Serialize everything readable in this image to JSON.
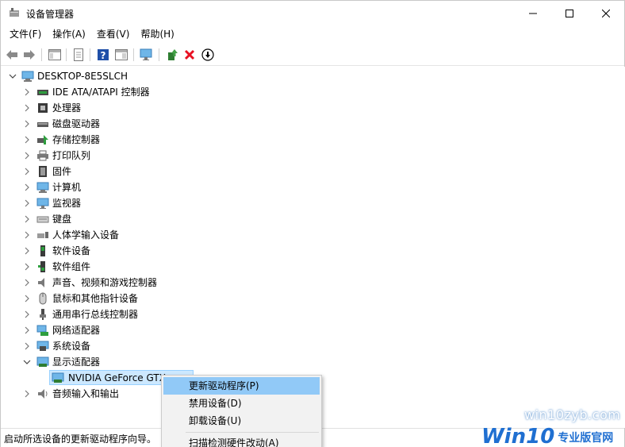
{
  "window": {
    "title": "设备管理器",
    "controls": {
      "minimize": "—",
      "maximize": "☐",
      "close": "✕"
    }
  },
  "menubar": [
    {
      "label": "文件(F)"
    },
    {
      "label": "操作(A)"
    },
    {
      "label": "查看(V)"
    },
    {
      "label": "帮助(H)"
    }
  ],
  "toolbar": {
    "buttons": [
      "back-icon",
      "forward-icon",
      "show-hide-console-tree-icon",
      "properties-icon",
      "help-icon",
      "action-pane-icon",
      "scan-hardware-icon",
      "update-driver-icon",
      "uninstall-icon",
      "disable-icon"
    ]
  },
  "tree": {
    "root": "DESKTOP-8E5SLCH",
    "items": [
      {
        "label": "IDE ATA/ATAPI 控制器",
        "icon": "ide-controller-icon",
        "expanded": false
      },
      {
        "label": "处理器",
        "icon": "processor-icon",
        "expanded": false
      },
      {
        "label": "磁盘驱动器",
        "icon": "disk-drive-icon",
        "expanded": false
      },
      {
        "label": "存储控制器",
        "icon": "storage-controller-icon",
        "expanded": false
      },
      {
        "label": "打印队列",
        "icon": "printer-icon",
        "expanded": false
      },
      {
        "label": "固件",
        "icon": "firmware-icon",
        "expanded": false
      },
      {
        "label": "计算机",
        "icon": "computer-icon",
        "expanded": false
      },
      {
        "label": "监视器",
        "icon": "monitor-icon",
        "expanded": false
      },
      {
        "label": "键盘",
        "icon": "keyboard-icon",
        "expanded": false
      },
      {
        "label": "人体学输入设备",
        "icon": "hid-icon",
        "expanded": false
      },
      {
        "label": "软件设备",
        "icon": "software-device-icon",
        "expanded": false
      },
      {
        "label": "软件组件",
        "icon": "software-component-icon",
        "expanded": false
      },
      {
        "label": "声音、视频和游戏控制器",
        "icon": "sound-icon",
        "expanded": false
      },
      {
        "label": "鼠标和其他指针设备",
        "icon": "mouse-icon",
        "expanded": false
      },
      {
        "label": "通用串行总线控制器",
        "icon": "usb-icon",
        "expanded": false
      },
      {
        "label": "网络适配器",
        "icon": "network-adapter-icon",
        "expanded": false
      },
      {
        "label": "系统设备",
        "icon": "system-device-icon",
        "expanded": false
      },
      {
        "label": "显示适配器",
        "icon": "display-adapter-icon",
        "expanded": true
      },
      {
        "label": "NVIDIA GeForce GTX",
        "icon": "display-adapter-icon",
        "child": true,
        "selected": true
      },
      {
        "label": "音频输入和输出",
        "icon": "audio-io-icon",
        "expanded": false
      }
    ]
  },
  "context_menu": {
    "items": [
      {
        "label": "更新驱动程序(P)",
        "highlighted": true
      },
      {
        "label": "禁用设备(D)"
      },
      {
        "label": "卸载设备(U)"
      },
      {
        "label": "扫描检测硬件改动(A)"
      }
    ]
  },
  "statusbar": {
    "text": "启动所选设备的更新驱动程序向导。"
  },
  "watermark": {
    "url": "win10zyb.com",
    "logo_main": "Win10",
    "logo_sub": "专业版官网"
  },
  "colors": {
    "selection_bg": "#cce8ff",
    "menu_highlight": "#91c9f7",
    "uninstall_red": "#e81123",
    "help_blue": "#1f4fa8",
    "brand_blue": "#1f6fd1"
  }
}
